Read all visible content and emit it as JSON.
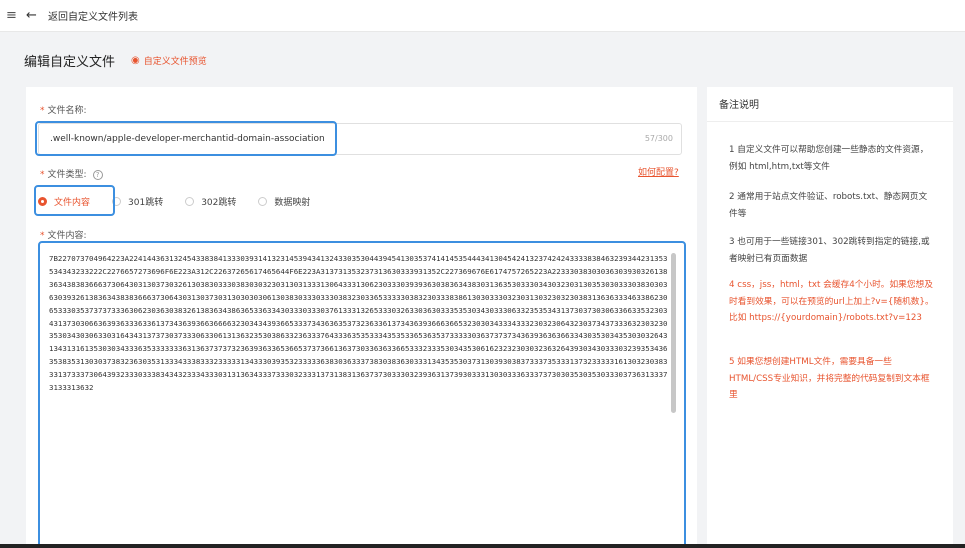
{
  "topbar": {
    "menu_icon": "≡",
    "back_icon": "←",
    "back_label": "返回自定义文件列表"
  },
  "header": {
    "title": "编辑自定义文件",
    "preview_icon": "◉",
    "preview_label": "自定义文件预览"
  },
  "form": {
    "name_label": "文件名称:",
    "name_value": ".well-known/apple-developer-merchantid-domain-association",
    "name_counter": "57/300",
    "type_label": "文件类型:",
    "help_icon": "?",
    "how_config": "如何配置?",
    "types": [
      {
        "label": "文件内容",
        "selected": true
      },
      {
        "label": "301跳转",
        "selected": false
      },
      {
        "label": "302跳转",
        "selected": false
      },
      {
        "label": "数据映射",
        "selected": false
      }
    ],
    "content_label": "文件内容:",
    "content_value": "7B227073704964223A2241443631324543383841333039314132314539434132433035304439454130353741414535444341304542413237424243333838463239344231353534343233222C2276657273696F6E223A312C22637265617465644F6E223A313731353237313630333931352C227369676E6174757265223A22333038303036303930326138363438383666373064303130373032613038303330383030323031303133313064333130623033303939363038363438303136353033303430323031303530303330383030363039326138363438383666373064303130373031303030306130383033303330383230336533333038323033383861303033303230313032303230383136363334633862306533303537373733363062303630383261383634386365336334303330333037613331326533303263303630333535303430333063323535343137303730306336633532303431373030663639363336336137343639366366663230343439366533373436363537323633613734363936663665323030343334333230323064323037343733363230323035303430306330316434313737303733306330613136323530386332363337643336353533343535336536353733333036373737343639363636633430353034353030326431343131613530303433363533333336313637373732363936336536653737366136373033636336653332333530343530616232323030323632643930343033303239353436353835313030373832363035313334333833323333313433303935323333363830363337383038363033313435353037313039303837333735333137323333316130323038333137333730643932333033383434323334333031313634333733303233313731383136373730333032393631373930333130303336333737303035303530333037363133373133313632"
  },
  "sidebar": {
    "title": "备注说明",
    "notes": [
      "1 自定义文件可以帮助您创建一些静态的文件资源，例如 html,htm,txt等文件",
      "2 通常用于站点文件验证、robots.txt、静态网页文件等",
      "3 也可用于一些链接301、302跳转到指定的链接,或者映射已有页面数据",
      "4 css，jss，html，txt 会缓存4个小时。如果您想及时看到效果，可以在预览的url上加上?v={随机数}。比如 https://{yourdomain}/robots.txt?v=123",
      "5 如果您想创建HTML文件，需要具备一些HTML/CSS专业知识，并将完整的代码复制到文本框里"
    ]
  },
  "colors": {
    "accent": "#e8542f",
    "highlight": "#3c8fe0"
  }
}
